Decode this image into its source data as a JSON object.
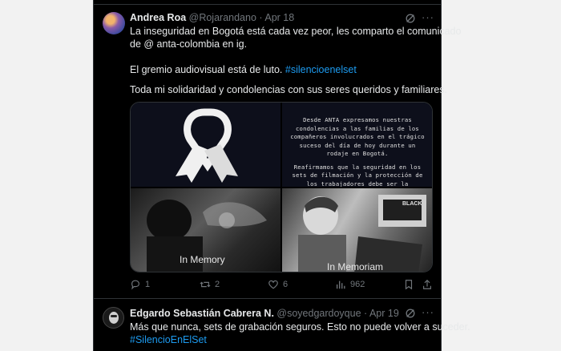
{
  "tweets": [
    {
      "author": "Andrea Roa",
      "handle": "@Rojarandano",
      "date": "· Apr 18",
      "lines": [
        "La inseguridad en Bogotá está cada vez peor,  les comparto el comunicado",
        "de @ anta-colombia en ig."
      ],
      "line3_prefix": "El gremio audiovisual está de luto. ",
      "line3_tag": "#silencioenelset",
      "line4": "Toda mi solidaridad y condolencias con sus seres queridos y familiares.",
      "media": {
        "statement_p1": "Desde ANTA expresamos nuestras condolencias a las familias de los compañeros involucrados en el trágico suceso del día de hoy durante un rodaje en Bogotá.",
        "statement_p2": "Reafirmamos que la seguridad en los sets de filmación y la protección de los trabajadores debe ser la prioridad, y",
        "caption_left": "In Memory",
        "caption_right": "In Memoriam",
        "sign_text": "BLACK"
      },
      "actions": {
        "replies": "1",
        "retweets": "2",
        "likes": "6",
        "views": "962"
      }
    },
    {
      "author": "Edgardo Sebastián Cabrera N.",
      "handle": "@soyedgardoyque",
      "date": "· Apr 19",
      "line1": "Más que nunca, sets de grabación seguros. Esto no puede volver a suceder.",
      "tag": "#SilencioEnElSet"
    }
  ],
  "colors": {
    "background": "#000000",
    "text": "#e7e9ea",
    "muted": "#71767b",
    "link": "#1d9bf0",
    "border": "#2f3336"
  }
}
